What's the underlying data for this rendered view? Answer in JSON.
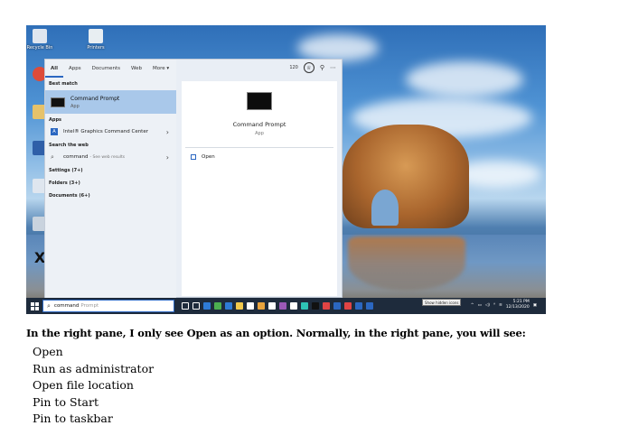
{
  "desktop": {
    "icons": [
      {
        "label": "Recycle Bin",
        "color": "#dfe6ef"
      },
      {
        "label": "Printers",
        "color": "#e8eef2"
      },
      {
        "label": "Google Chrome",
        "color": "#dd4b39"
      },
      {
        "label": "Folder",
        "color": "#e6c26a"
      },
      {
        "label": "VirtualBox",
        "color": "#2f5fa8"
      },
      {
        "label": "Settings",
        "color": "#dfe6ef"
      },
      {
        "label": "Shortcut",
        "color": "#c9d3de"
      },
      {
        "label": "X",
        "color": "#111111"
      }
    ]
  },
  "start_menu": {
    "tabs": [
      "All",
      "Apps",
      "Documents",
      "Web",
      "More ▾"
    ],
    "reward_points": "120",
    "best_match_label": "Best match",
    "best_match": {
      "title": "Command Prompt",
      "subtitle": "App"
    },
    "apps_label": "Apps",
    "app_item": "Intel® Graphics Command Center",
    "search_web_label": "Search the web",
    "web_item": {
      "query": "command",
      "hint": "- See web results"
    },
    "settings_label": "Settings (7+)",
    "folders_label": "Folders (3+)",
    "documents_label": "Documents (6+)",
    "preview": {
      "title": "Command Prompt",
      "subtitle": "App",
      "action": "Open"
    }
  },
  "taskbar": {
    "search_typed": "command",
    "search_ghost": "Prompt",
    "tooltip": "Show hidden icons",
    "time": "5:21 PM",
    "date": "12/13/2020",
    "icon_colors": [
      "#ffffff",
      "#ffffff",
      "#2e7bd6",
      "#4caf50",
      "#2e7bd6",
      "#f2c94c",
      "#ffffff",
      "#e8a33d",
      "#ffffff",
      "#9b59b6",
      "#ffffff",
      "#2ec4b6",
      "#111111",
      "#e04444",
      "#2b67c1",
      "#e04444",
      "#2b67c1",
      "#2b67c1"
    ]
  },
  "note": {
    "heading": "In the right pane, I only see Open as an option.  Normally, in the right pane, you will see:",
    "items": [
      "Open",
      "Run as administrator",
      "Open file location",
      "Pin to Start",
      "Pin to taskbar"
    ]
  }
}
